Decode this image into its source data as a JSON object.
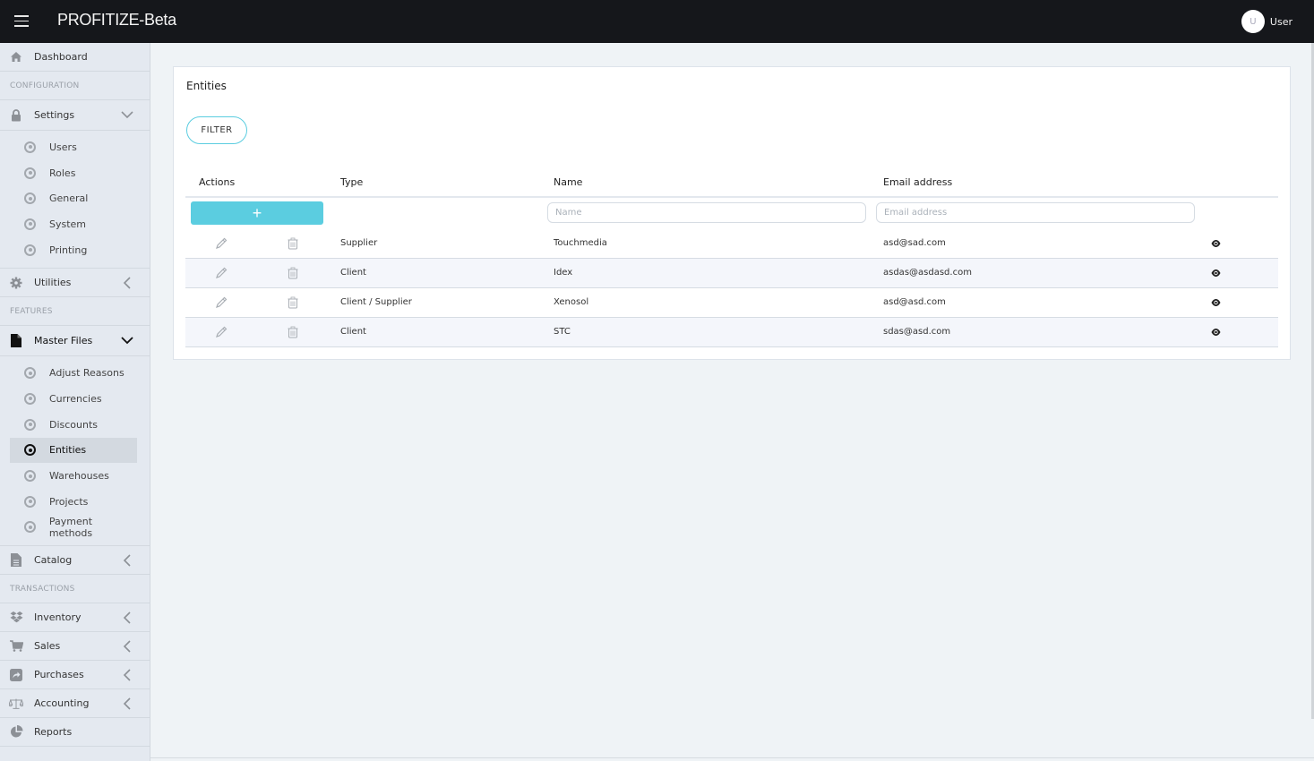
{
  "app": {
    "title": "PROFITIZE-Beta"
  },
  "user": {
    "initial": "U",
    "name": "User"
  },
  "sidebar": {
    "dashboard": "Dashboard",
    "sections": {
      "configuration": "CONFIGURATION",
      "features": "FEATURES",
      "transactions": "TRANSACTIONS"
    },
    "settings": {
      "label": "Settings",
      "items": [
        "Users",
        "Roles",
        "General",
        "System",
        "Printing"
      ]
    },
    "utilities": "Utilities",
    "master_files": {
      "label": "Master Files",
      "items": [
        "Adjust Reasons",
        "Currencies",
        "Discounts",
        "Entities",
        "Warehouses",
        "Projects",
        "Payment methods"
      ],
      "active": "Entities"
    },
    "catalog": "Catalog",
    "inventory": "Inventory",
    "sales": "Sales",
    "purchases": "Purchases",
    "accounting": "Accounting",
    "reports": "Reports"
  },
  "main": {
    "title": "Entities",
    "filter_label": "FILTER",
    "add_label": "+",
    "columns": {
      "actions": "Actions",
      "type": "Type",
      "name": "Name",
      "email": "Email address"
    },
    "filters": {
      "name_placeholder": "Name",
      "email_placeholder": "Email address"
    },
    "rows": [
      {
        "type": "Supplier",
        "name": "Touchmedia",
        "email": "asd@sad.com"
      },
      {
        "type": "Client",
        "name": "Idex",
        "email": "asdas@asdasd.com"
      },
      {
        "type": "Client / Supplier",
        "name": "Xenosol",
        "email": "asd@asd.com"
      },
      {
        "type": "Client",
        "name": "STC",
        "email": "sdas@asd.com"
      }
    ]
  },
  "colors": {
    "topbar": "#15171b",
    "accent": "#5bcde0",
    "sidebar": "#e4e9f0",
    "content_bg": "#eff3f6"
  }
}
